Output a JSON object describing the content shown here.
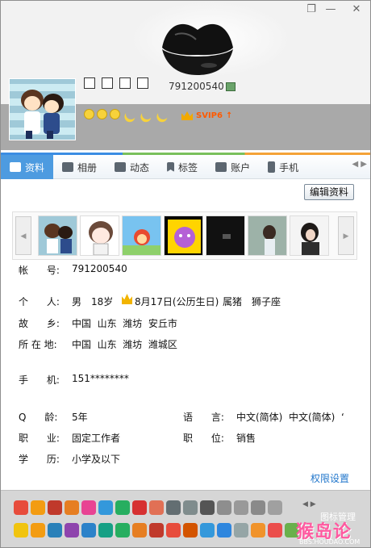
{
  "window": {
    "skin_icon": "skin-icon",
    "minimize_label": "—",
    "close_label": "✕"
  },
  "profile": {
    "nickname_boxes": 4,
    "qq_number": "791200540",
    "svip_label": "SVIP6",
    "svip_arrow": "↑"
  },
  "tabs": [
    {
      "label": "资料",
      "icon": "profile-card-icon",
      "active": true
    },
    {
      "label": "相册",
      "icon": "album-icon"
    },
    {
      "label": "动态",
      "icon": "feed-icon"
    },
    {
      "label": "标签",
      "icon": "bookmark-icon"
    },
    {
      "label": "账户",
      "icon": "wallet-icon"
    },
    {
      "label": "手机",
      "icon": "phone-icon"
    }
  ],
  "tab_arrows": "◀ ▶",
  "edit_button": "编辑资料",
  "strip": {
    "left": "◀",
    "right": "▶"
  },
  "fields": {
    "account_label": "帐      号:",
    "account_value": "791200540",
    "person_label": "个      人:",
    "gender": "男",
    "age": "18岁",
    "birthday": "8月17日(公历生日)",
    "zodiac": "属猪",
    "star": "狮子座",
    "hometown_label": "故      乡:",
    "hometown": "中国  山东  潍坊  安丘市",
    "location_label": "所 在 地:",
    "location": "中国  山东  潍坊  潍城区",
    "phone_label": "手      机:",
    "phone": "151********",
    "qage_label": "Q      龄:",
    "qage": "5年",
    "lang_label": "语      言:",
    "lang": "中文(简体)  中文(简体)  ‘",
    "job_label": "职      业:",
    "job": "固定工作者",
    "post_label": "职      位:",
    "post": "销售",
    "edu_label": "学      历:",
    "edu": "小学及以下"
  },
  "permission_link": "权限设置",
  "bottom": {
    "manage_label": "图标管理",
    "arrows": "◀ ▶"
  },
  "watermark": {
    "text": "猴岛论坛",
    "url": "BBS.HOUDAO.COM"
  },
  "colors": {
    "accent": "#4d9be0",
    "link": "#2277cc",
    "svip": "#ff5a00"
  }
}
